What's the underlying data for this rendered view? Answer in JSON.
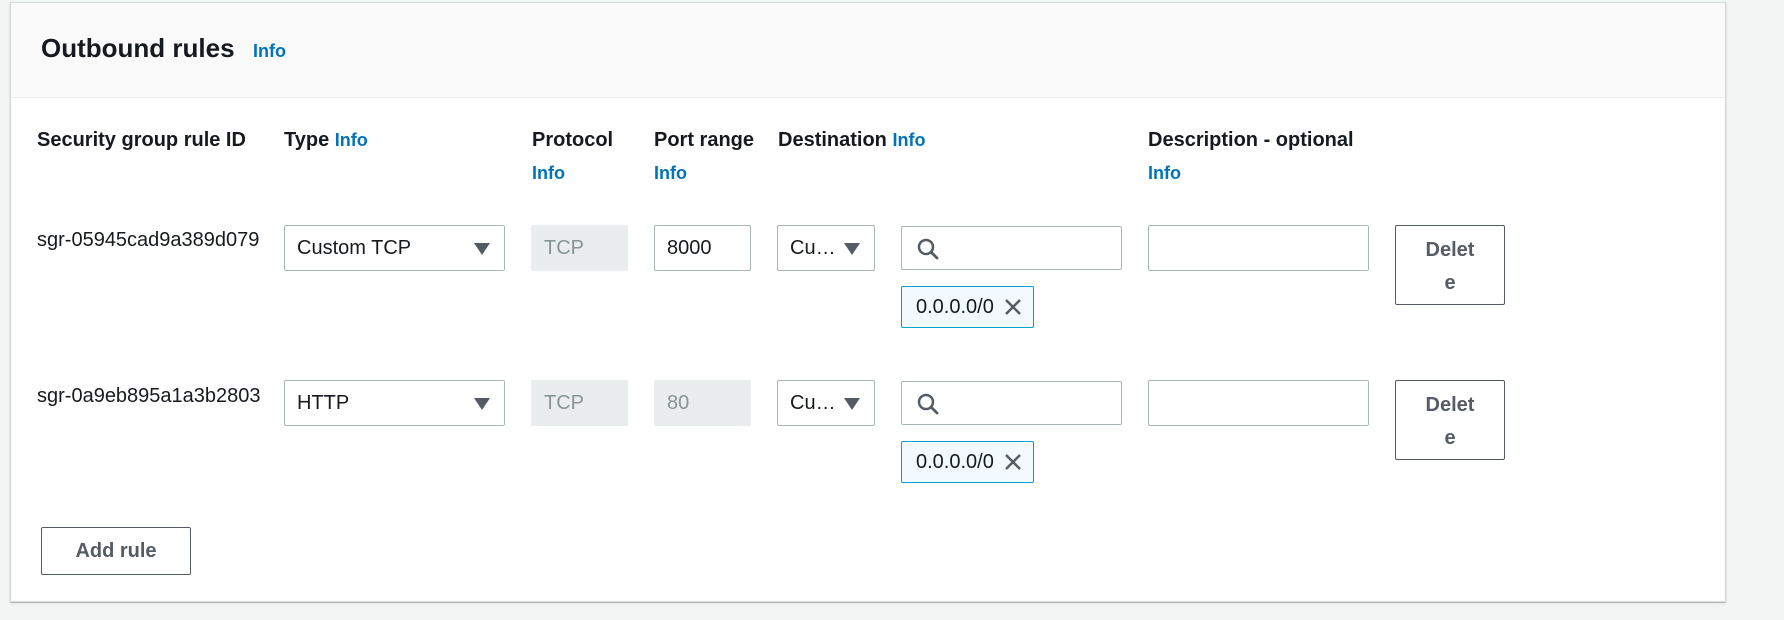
{
  "panel": {
    "title": "Outbound rules",
    "title_info": "Info"
  },
  "columns": {
    "rule_id": "Security group rule ID",
    "type": "Type",
    "type_info": "Info",
    "protocol": "Protocol",
    "protocol_info": "Info",
    "port_range": "Port range",
    "port_range_info": "Info",
    "destination": "Destination",
    "destination_info": "Info",
    "description": "Description - optional",
    "description_info": "Info"
  },
  "rules": [
    {
      "id": "sgr-05945cad9a389d079",
      "type": "Custom TCP",
      "protocol": "TCP",
      "port_range": "8000",
      "destination_type": "Cu…",
      "search_value": "",
      "cidr_token": "0.0.0.0/0",
      "description": "",
      "delete_label": "Delete"
    },
    {
      "id": "sgr-0a9eb895a1a3b2803",
      "type": "HTTP",
      "protocol": "TCP",
      "port_range": "80",
      "destination_type": "Cu…",
      "search_value": "",
      "cidr_token": "0.0.0.0/0",
      "description": "",
      "delete_label": "Delete"
    }
  ],
  "add_rule_label": "Add rule",
  "icons": {
    "caret": "caret-down-icon",
    "search": "search-icon",
    "remove": "close-icon"
  },
  "colors": {
    "link": "#0073bb",
    "token_border": "#00a1c9",
    "token_bg": "#f1faff",
    "disabled_bg": "#eaeded"
  }
}
